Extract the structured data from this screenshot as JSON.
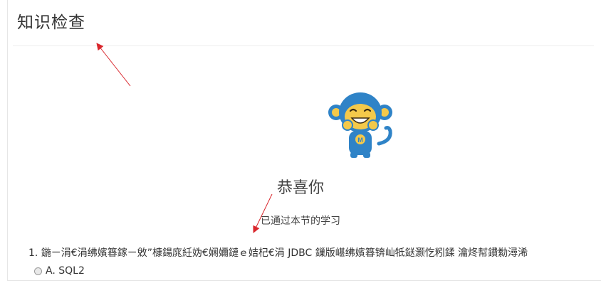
{
  "header": {
    "title": "知识检查"
  },
  "result": {
    "heading": "恭喜你",
    "subtext": "已通过本节的学习",
    "mascot_icon": "monkey-mascot-icon"
  },
  "questions": [
    {
      "number": "1.",
      "text": "鍦ㄧ涓€涓绋嬪簭鎵ㄧ敓”槺鍚庣紝妫€娴嬭鏈ｅ姞杞€涓 JDBC 鏁版嵁绋嬪簭锛屾牴鎹灏忔粌鍒 瀹炵幇鐨勬潯浠",
      "options": [
        {
          "label": "A. SQL2",
          "selected": false
        }
      ]
    }
  ],
  "colors": {
    "annotation_arrow": "#d9262c",
    "mascot_blue": "#2f83c7",
    "mascot_face": "#f4c94a"
  }
}
